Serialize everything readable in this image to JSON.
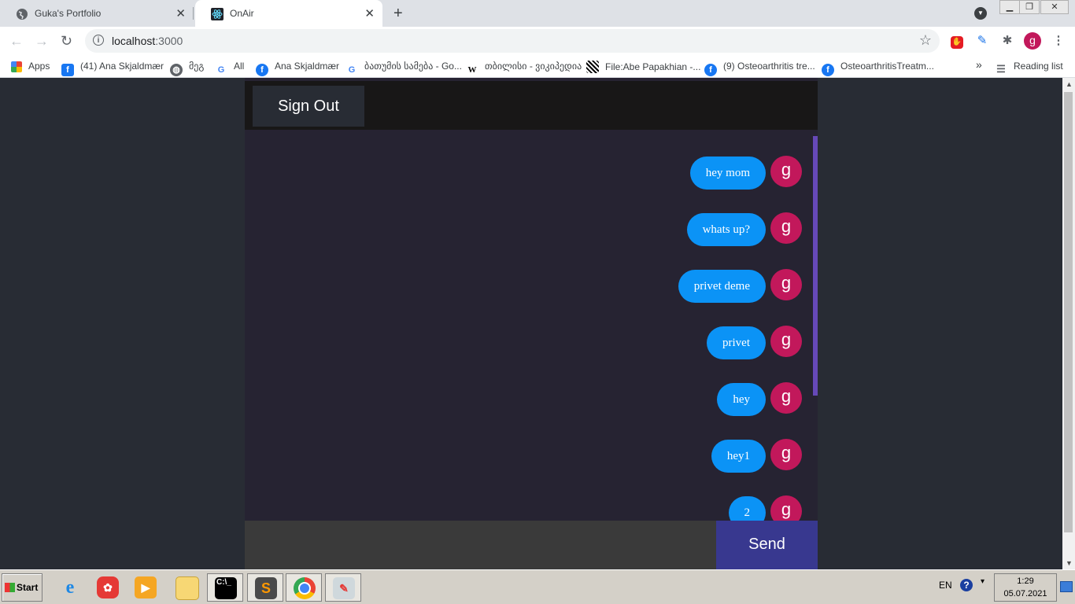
{
  "browser": {
    "tabs": [
      {
        "title": "Guka's Portfolio",
        "icon": "globe-icon",
        "active": false
      },
      {
        "title": "OnAir",
        "icon": "react-icon",
        "active": true
      }
    ],
    "url_host": "localhost",
    "url_port": ":3000",
    "bookmarks": [
      {
        "label": "Apps",
        "icon": "apps-grid-icon"
      },
      {
        "label": "(41) Ana Skjaldmær",
        "icon": "facebook-icon"
      },
      {
        "label": "მეგ",
        "icon": "globe-icon"
      },
      {
        "label": "All",
        "icon": "google-icon"
      },
      {
        "label": "Ana Skjaldmær",
        "icon": "facebook-icon"
      },
      {
        "label": "ბათუმის სამება - Go...",
        "icon": "google-icon"
      },
      {
        "label": "თბილისი - ვიკიპედია",
        "icon": "wikipedia-icon"
      },
      {
        "label": "File:Abe Papakhian -...",
        "icon": "image-icon"
      },
      {
        "label": "(9) Osteoarthritis tre...",
        "icon": "facebook-icon"
      },
      {
        "label": "OsteoarthritisTreatm...",
        "icon": "facebook-icon"
      }
    ],
    "more_bookmarks": "»",
    "reading_list": "Reading list",
    "profile_initial": "g"
  },
  "app": {
    "sign_out_label": "Sign Out",
    "send_label": "Send",
    "input_value": "",
    "messages": [
      {
        "text": "hey mom",
        "avatar": "g"
      },
      {
        "text": "whats up?",
        "avatar": "g"
      },
      {
        "text": "privet deme",
        "avatar": "g"
      },
      {
        "text": "privet",
        "avatar": "g"
      },
      {
        "text": "hey",
        "avatar": "g"
      },
      {
        "text": "hey1",
        "avatar": "g"
      },
      {
        "text": "2",
        "avatar": "g"
      }
    ]
  },
  "taskbar": {
    "start_label": "Start",
    "language": "EN",
    "time": "1:29",
    "date": "05.07.2021",
    "apps": [
      "internet-explorer-icon",
      "jumpshare-icon",
      "media-player-icon",
      "file-explorer-icon",
      "command-prompt-icon",
      "sublime-text-icon",
      "chrome-icon",
      "paint-icon"
    ]
  },
  "colors": {
    "bubble": "#0b93f6",
    "avatar": "#c2185b",
    "send_button": "#38388f",
    "app_bg": "#262332",
    "page_bg": "#282c34"
  }
}
